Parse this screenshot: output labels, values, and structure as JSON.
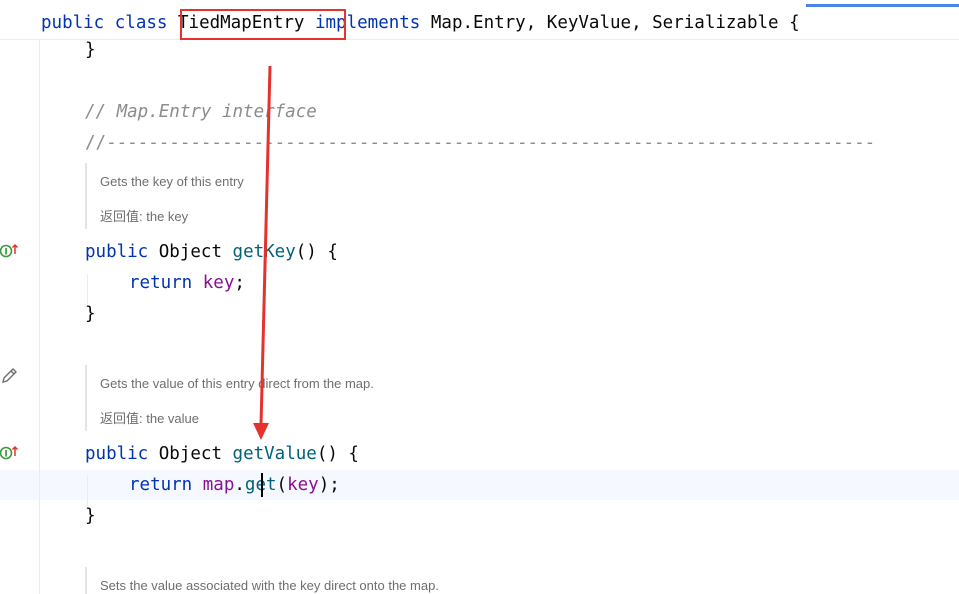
{
  "header": {
    "kw_public": "public",
    "kw_class": "class",
    "class_name": "TiedMapEntry",
    "kw_implements": "implements",
    "interfaces": "Map.Entry, KeyValue, Serializable {"
  },
  "lines": {
    "brace_close_1": "}",
    "comment_title": "// Map.Entry interface",
    "comment_divider": "//-------------------------------------------------------------------------",
    "getkey_kw": "public",
    "getkey_type": "Object",
    "getkey_name": "getKey",
    "getkey_sig": "() {",
    "getkey_return_kw": "return",
    "getkey_return_val": "key",
    "getkey_semicolon": ";",
    "brace_close_2": "}",
    "getvalue_kw": "public",
    "getvalue_type": "Object",
    "getvalue_name": "getValue",
    "getvalue_sig": "() {",
    "getvalue_return_kw": "return",
    "getvalue_map": "map",
    "getvalue_dot": ".",
    "getvalue_get": "get",
    "getvalue_paren_open": "(",
    "getvalue_key": "key",
    "getvalue_paren_close": ");",
    "brace_close_3": "}"
  },
  "docs": {
    "getkey_desc": "Gets the key of this entry",
    "getkey_return": "返回值: the key",
    "getvalue_desc": "Gets the value of this entry direct from the map.",
    "getvalue_return": "返回值: the value",
    "setvalue_desc": "Sets the value associated with the key direct onto the map."
  },
  "icons": {
    "implements_icon_1": "implements-method-icon",
    "implements_icon_2": "implements-method-icon",
    "edit_icon": "pencil-icon"
  },
  "colors": {
    "keyword": "#0033b3",
    "method": "#00627a",
    "field": "#871094",
    "comment": "#8c8c8c",
    "annotation_red": "#e5322d"
  }
}
